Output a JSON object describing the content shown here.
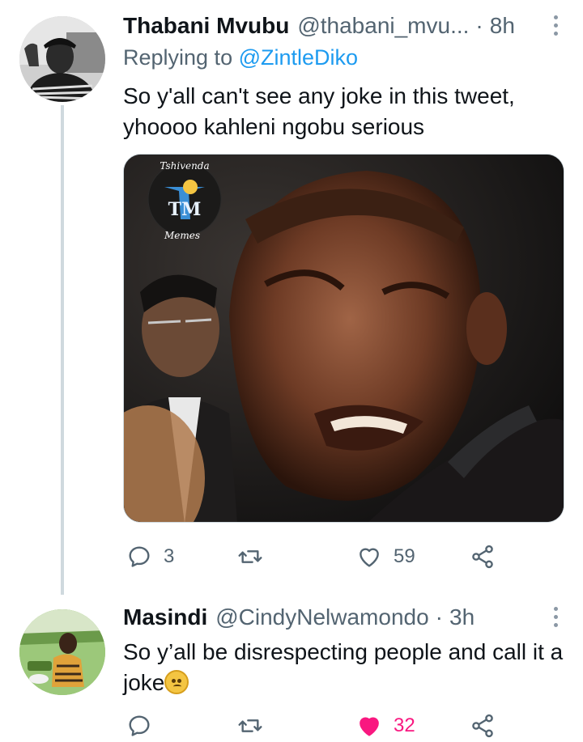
{
  "tweets": [
    {
      "name": "Thabani Mvubu",
      "handle": "@thabani_mvu...",
      "separator": "·",
      "time": "8h",
      "replying_prefix": "Replying to",
      "replying_to": "@ZintleDiko",
      "text": "So y'all can't see any joke in this tweet, yhoooo kahleni ngobu serious",
      "media": {
        "logo_top": "Tshivenda",
        "logo_bottom": "Memes",
        "logo_mark": "TM"
      },
      "stats": {
        "replies": "3",
        "retweets": "",
        "likes": "59"
      },
      "liked": false
    },
    {
      "name": "Masindi",
      "handle": "@CindyNelwamondo",
      "separator": "·",
      "time": "3h",
      "text": "So y’all be disrespecting people and call it a joke",
      "emoji": "woozy-face",
      "stats": {
        "replies": "",
        "retweets": "",
        "likes": "32"
      },
      "liked": true
    }
  ],
  "colors": {
    "accent": "#1d9bf0",
    "like": "#f91880",
    "muted": "#536471",
    "thread_line": "#cfd9de"
  },
  "icons": {
    "reply": "reply-icon",
    "retweet": "retweet-icon",
    "like": "heart-icon",
    "share": "share-icon",
    "more": "more-icon"
  }
}
